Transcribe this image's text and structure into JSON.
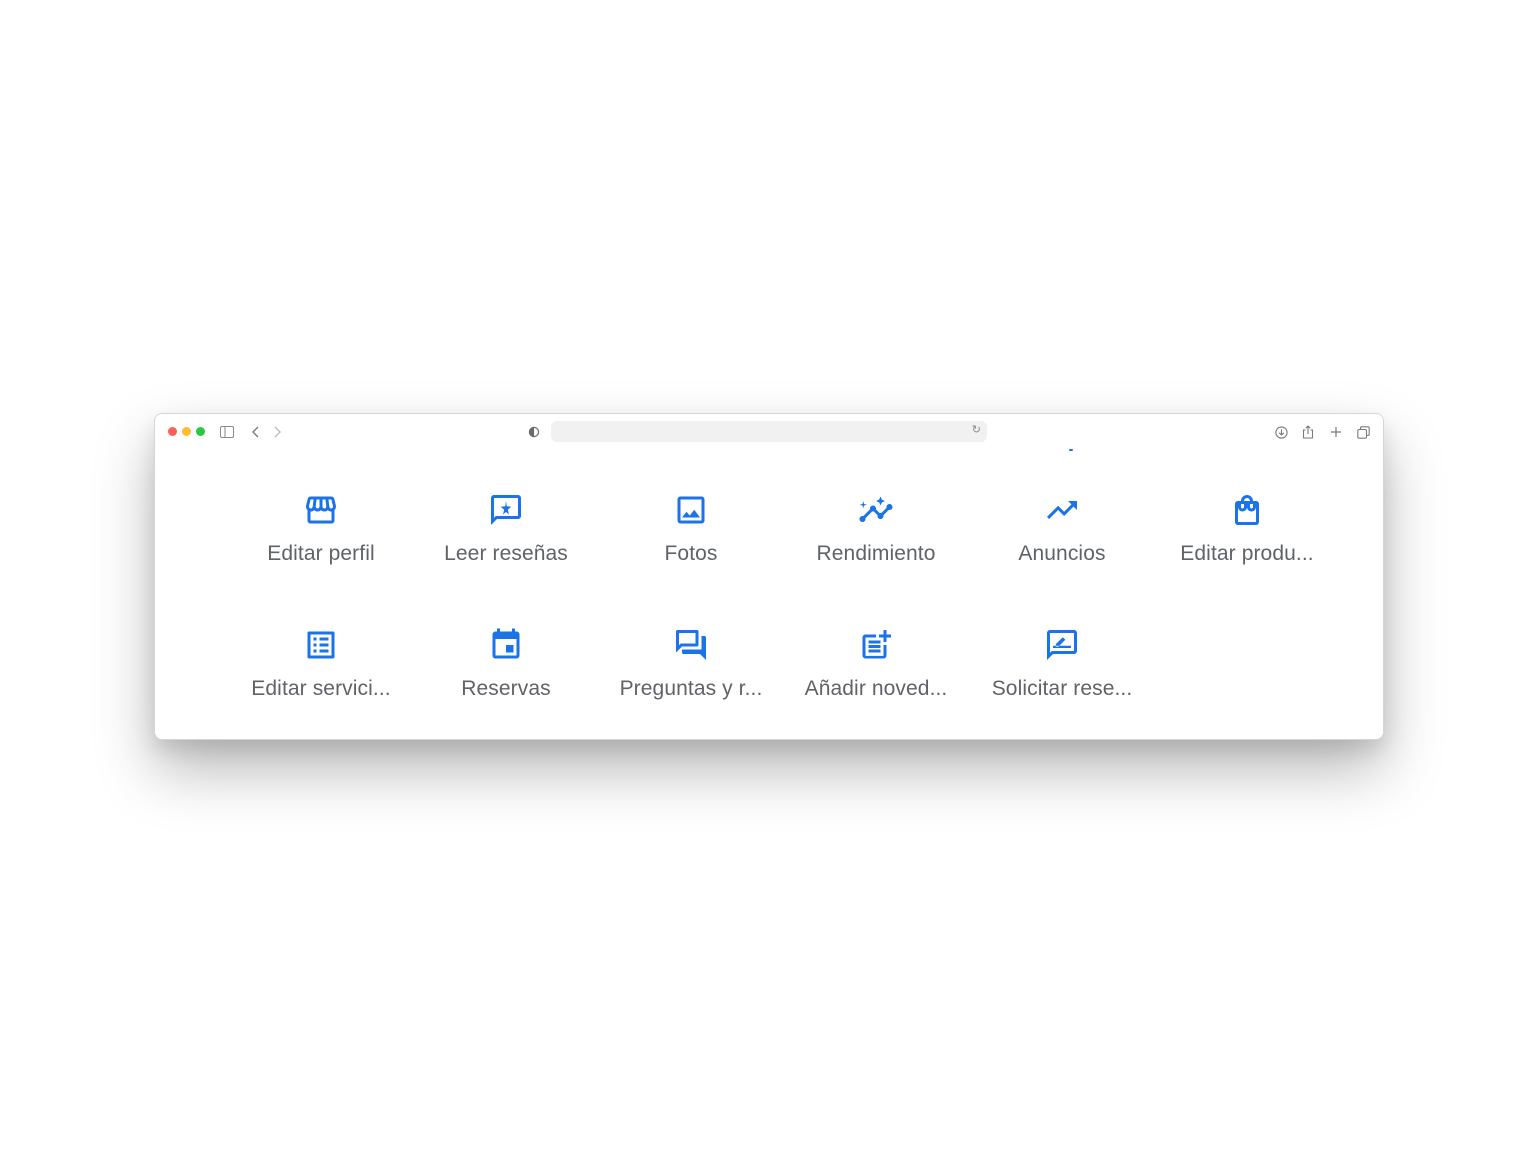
{
  "browser": {
    "traffic_lights": {
      "close": "#ff5f57",
      "minimize": "#febc2e",
      "zoom": "#28c840"
    },
    "url": ""
  },
  "colors": {
    "accent": "#1a73e8",
    "label": "#5f6368"
  },
  "actions": [
    {
      "label": "Editar perfil",
      "icon": "storefront-icon"
    },
    {
      "label": "Leer reseñas",
      "icon": "review-star-icon"
    },
    {
      "label": "Fotos",
      "icon": "image-icon"
    },
    {
      "label": "Rendimiento",
      "icon": "insights-icon"
    },
    {
      "label": "Anuncios",
      "icon": "trending-up-icon"
    },
    {
      "label": "Editar produ...",
      "icon": "shopping-bag-icon"
    },
    {
      "label": "Editar servici...",
      "icon": "list-icon"
    },
    {
      "label": "Reservas",
      "icon": "calendar-icon"
    },
    {
      "label": "Preguntas y r...",
      "icon": "forum-icon"
    },
    {
      "label": "Añadir noved...",
      "icon": "post-add-icon"
    },
    {
      "label": "Solicitar rese...",
      "icon": "rate-review-icon"
    }
  ]
}
